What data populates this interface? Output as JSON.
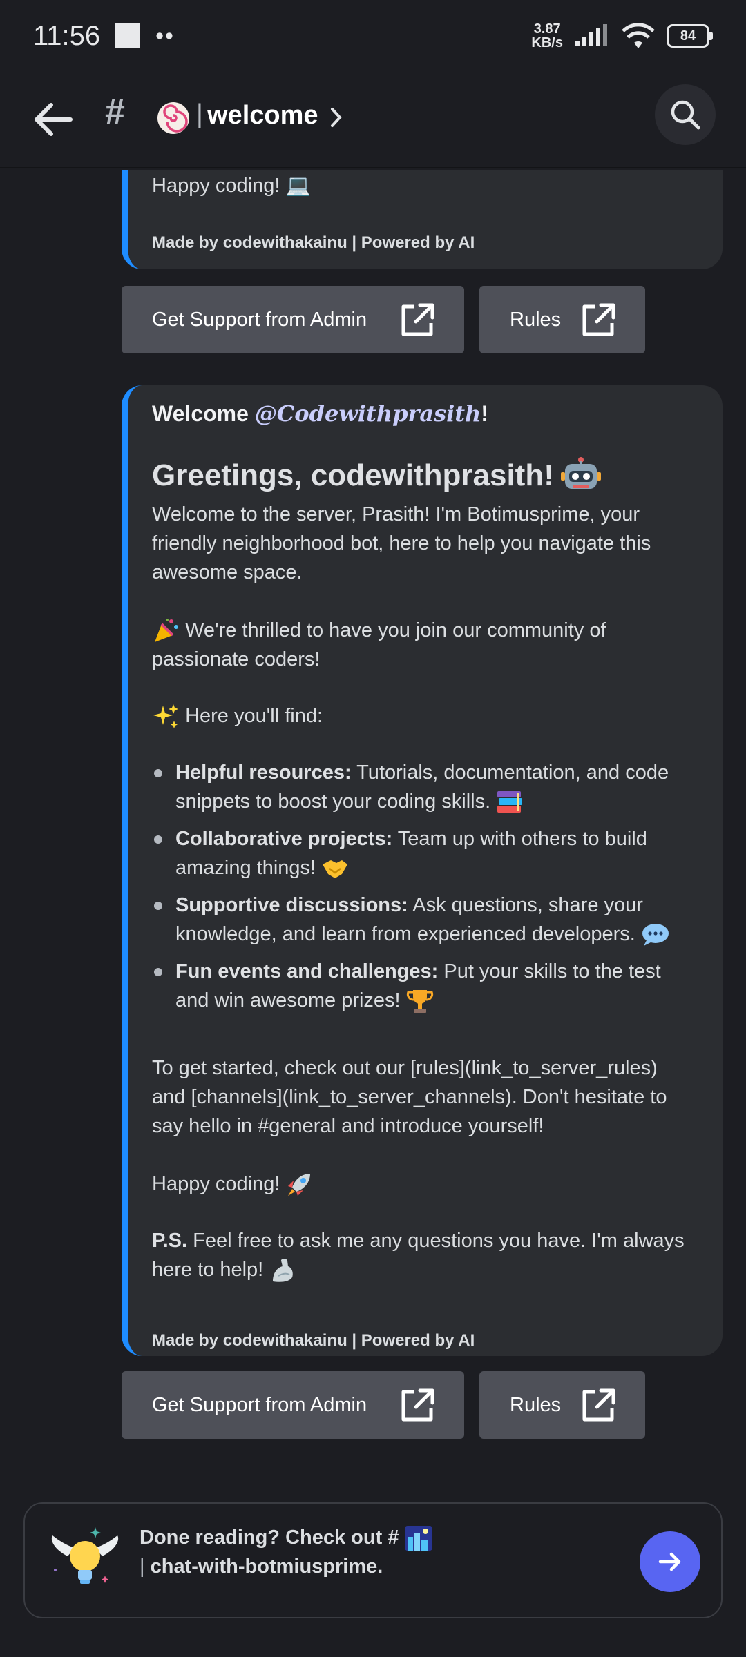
{
  "status_bar": {
    "time": "11:56",
    "net_speed_value": "3.87",
    "net_speed_unit": "KB/s",
    "battery": "84"
  },
  "header": {
    "channel_emoji": "naruto-emoji",
    "channel_name": "welcome"
  },
  "top_embed": {
    "happy_coding": "Happy coding! 💻",
    "footer": "Made by codewithakainu | Powered by AI"
  },
  "buttons": {
    "support": "Get Support from Admin",
    "rules": "Rules"
  },
  "main_embed": {
    "welcome_prefix": "Welcome ",
    "mention": "@Codewithprasith",
    "welcome_suffix": "!",
    "greeting": "Greetings, codewithprasith!",
    "intro": "Welcome to the server, Prasith!  I'm Botimusprime, your friendly neighborhood bot, here to help you navigate this awesome space.",
    "thrilled": "We're thrilled to have you join our community of passionate coders!",
    "find_heading": "Here you'll find:",
    "features": [
      {
        "title": "Helpful resources:",
        "text": " Tutorials, documentation, and code snippets to boost your coding skills."
      },
      {
        "title": "Collaborative projects:",
        "text": " Team up with others to build amazing things!"
      },
      {
        "title": "Supportive discussions:",
        "text": " Ask questions, share your knowledge, and learn from experienced developers."
      },
      {
        "title": "Fun events and challenges:",
        "text": " Put your skills to the test and win awesome prizes!"
      }
    ],
    "get_started": "To get started, check out our [rules](link_to_server_rules) and [channels](link_to_server_channels). Don't hesitate to say hello in #general and introduce yourself!",
    "happy_coding": "Happy coding!",
    "ps_label": "P.S.",
    "ps_text": " Feel free to ask me any questions you have. I'm always here to help!",
    "footer": "Made by codewithakainu | Powered by AI"
  },
  "cta": {
    "line1": "Done reading? Check out #",
    "line2": "chat-with-botmiusprime."
  },
  "colors": {
    "accent": "#5865f2",
    "embed_bar": "#1e8cff",
    "background": "#1c1d22"
  }
}
